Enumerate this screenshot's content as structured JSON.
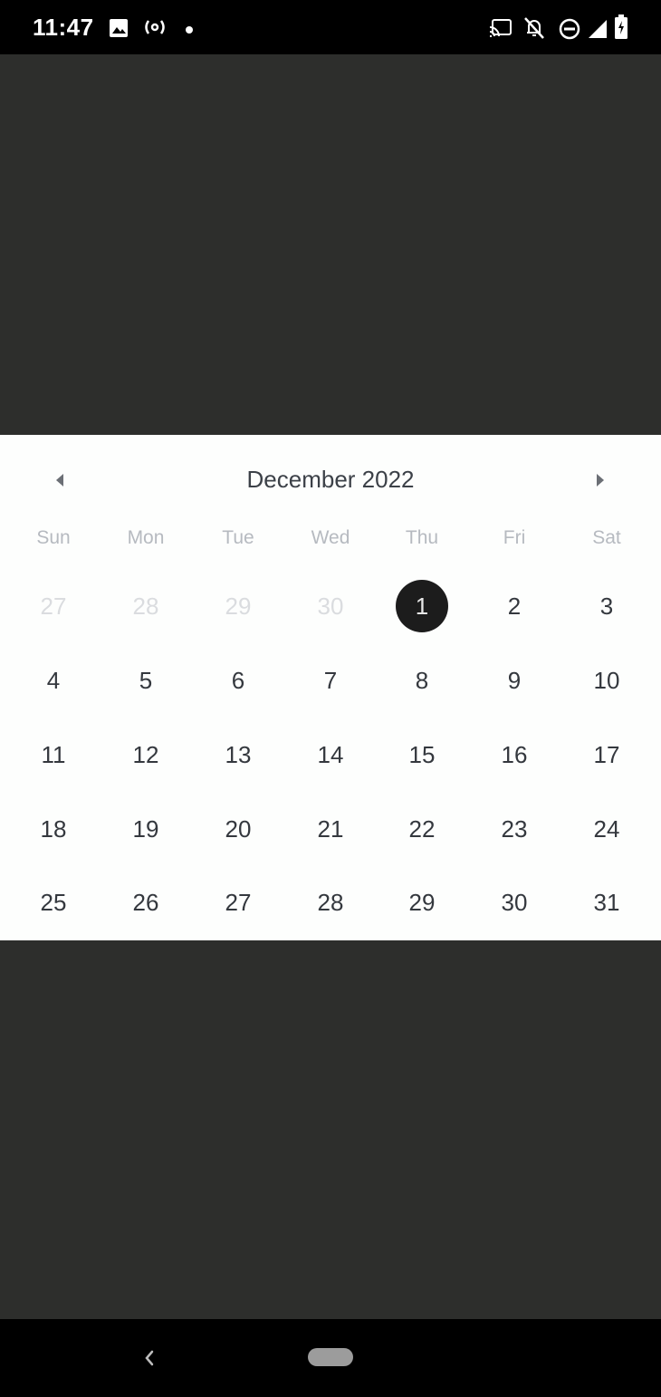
{
  "status_bar": {
    "time": "11:47",
    "left_icons": [
      "image-icon",
      "hotspot-icon",
      "dot-icon"
    ],
    "right_icons": [
      "cast-icon",
      "notifications-off-icon",
      "do-not-disturb-icon",
      "signal-icon",
      "battery-icon"
    ]
  },
  "calendar": {
    "title": "December 2022",
    "prev_icon": "chevron-left-icon",
    "next_icon": "chevron-right-icon",
    "weekdays": [
      "Sun",
      "Mon",
      "Tue",
      "Wed",
      "Thu",
      "Fri",
      "Sat"
    ],
    "weeks": [
      [
        {
          "d": "27",
          "out": true
        },
        {
          "d": "28",
          "out": true
        },
        {
          "d": "29",
          "out": true
        },
        {
          "d": "30",
          "out": true
        },
        {
          "d": "1",
          "selected": true
        },
        {
          "d": "2"
        },
        {
          "d": "3"
        }
      ],
      [
        {
          "d": "4"
        },
        {
          "d": "5"
        },
        {
          "d": "6"
        },
        {
          "d": "7"
        },
        {
          "d": "8"
        },
        {
          "d": "9"
        },
        {
          "d": "10"
        }
      ],
      [
        {
          "d": "11"
        },
        {
          "d": "12"
        },
        {
          "d": "13"
        },
        {
          "d": "14"
        },
        {
          "d": "15"
        },
        {
          "d": "16"
        },
        {
          "d": "17"
        }
      ],
      [
        {
          "d": "18"
        },
        {
          "d": "19"
        },
        {
          "d": "20"
        },
        {
          "d": "21"
        },
        {
          "d": "22"
        },
        {
          "d": "23"
        },
        {
          "d": "24"
        }
      ],
      [
        {
          "d": "25"
        },
        {
          "d": "26"
        },
        {
          "d": "27"
        },
        {
          "d": "28"
        },
        {
          "d": "29"
        },
        {
          "d": "30"
        },
        {
          "d": "31"
        }
      ]
    ],
    "colors": {
      "selected_bg": "#1c1c1c",
      "day_text": "#34383e",
      "outside_text": "#dadcdf",
      "weekday_text": "#b6bac0"
    }
  },
  "nav_bar": {
    "back_icon": "back-chevron-icon",
    "home_icon": "home-pill-icon"
  }
}
